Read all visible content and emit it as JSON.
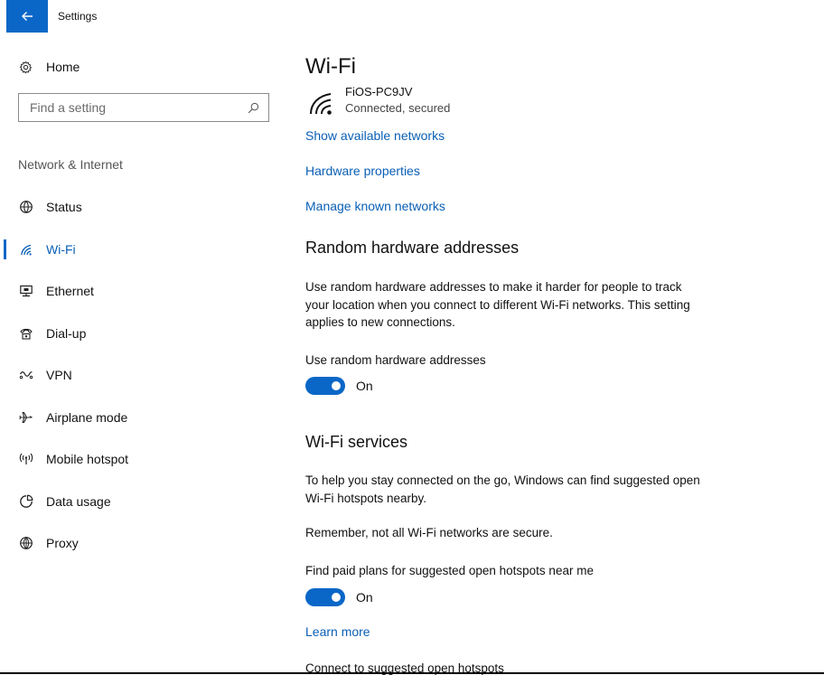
{
  "window": {
    "title": "Settings",
    "back_icon": "back-arrow-icon",
    "accent_color": "#0a67c7",
    "link_color": "#0a5fb5"
  },
  "sidebar": {
    "home": {
      "label": "Home",
      "icon": "gear-icon"
    },
    "search": {
      "placeholder": "Find a setting",
      "value": "",
      "icon": "search-icon"
    },
    "section_label": "Network & Internet",
    "items": [
      {
        "label": "Status",
        "icon": "globe-status-icon",
        "active": false
      },
      {
        "label": "Wi-Fi",
        "icon": "wifi-icon",
        "active": true
      },
      {
        "label": "Ethernet",
        "icon": "ethernet-icon",
        "active": false
      },
      {
        "label": "Dial-up",
        "icon": "dialup-icon",
        "active": false
      },
      {
        "label": "VPN",
        "icon": "vpn-icon",
        "active": false
      },
      {
        "label": "Airplane mode",
        "icon": "airplane-icon",
        "active": false
      },
      {
        "label": "Mobile hotspot",
        "icon": "hotspot-icon",
        "active": false
      },
      {
        "label": "Data usage",
        "icon": "data-usage-icon",
        "active": false
      },
      {
        "label": "Proxy",
        "icon": "proxy-globe-icon",
        "active": false
      }
    ]
  },
  "main": {
    "title": "Wi-Fi",
    "network": {
      "name": "FiOS-PC9JV",
      "status": "Connected, secured",
      "icon": "wifi-signal-icon"
    },
    "links": {
      "show_networks": "Show available networks",
      "hardware_properties": "Hardware properties",
      "manage_known": "Manage known networks"
    },
    "random_hw": {
      "heading": "Random hardware addresses",
      "description": "Use random hardware addresses to make it harder for people to track your location when you connect to different Wi-Fi networks. This setting applies to new connections.",
      "toggle_label": "Use random hardware addresses",
      "toggle_state": "On"
    },
    "wifi_services": {
      "heading": "Wi-Fi services",
      "description": "To help you stay connected on the go, Windows can find suggested open Wi-Fi hotspots nearby.",
      "warning": "Remember, not all Wi-Fi networks are secure.",
      "toggle_label": "Find paid plans for suggested open hotspots near me",
      "toggle_state": "On",
      "learn_more": "Learn more",
      "connect_label": "Connect to suggested open hotspots"
    }
  }
}
